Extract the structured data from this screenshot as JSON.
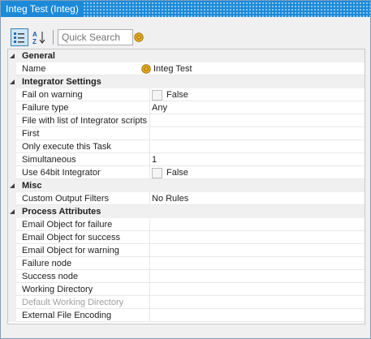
{
  "window": {
    "title": "Integ Test (Integ)"
  },
  "toolbar": {
    "categorized_icon": "categorized-view-icon",
    "alphabetical_icon": "alphabetical-sort-icon",
    "search_placeholder": "Quick Search",
    "script_icon": "coin-icon"
  },
  "categories": [
    {
      "label": "General",
      "props": [
        {
          "name": "Name",
          "value": "Integ Test",
          "icon": "coin-icon"
        }
      ]
    },
    {
      "label": "Integrator Settings",
      "props": [
        {
          "name": "Fail on warning",
          "value": "False",
          "checkbox": true
        },
        {
          "name": "Failure type",
          "value": "Any"
        },
        {
          "name": "File with list of Integrator scripts",
          "value": ""
        },
        {
          "name": "First",
          "value": ""
        },
        {
          "name": "Only execute this Task",
          "value": ""
        },
        {
          "name": "Simultaneous",
          "value": "1"
        },
        {
          "name": "Use 64bit Integrator",
          "value": "False",
          "checkbox": true
        }
      ]
    },
    {
      "label": "Misc",
      "props": [
        {
          "name": "Custom Output Filters",
          "value": "No Rules"
        }
      ]
    },
    {
      "label": "Process Attributes",
      "props": [
        {
          "name": "Email Object for failure",
          "value": ""
        },
        {
          "name": "Email Object for success",
          "value": ""
        },
        {
          "name": "Email Object for warning",
          "value": ""
        },
        {
          "name": "Failure node",
          "value": ""
        },
        {
          "name": "Success node",
          "value": ""
        },
        {
          "name": "Working Directory",
          "value": ""
        },
        {
          "name": "Default Working Directory",
          "value": "",
          "disabled": true
        },
        {
          "name": "External File Encoding",
          "value": ""
        }
      ]
    }
  ]
}
